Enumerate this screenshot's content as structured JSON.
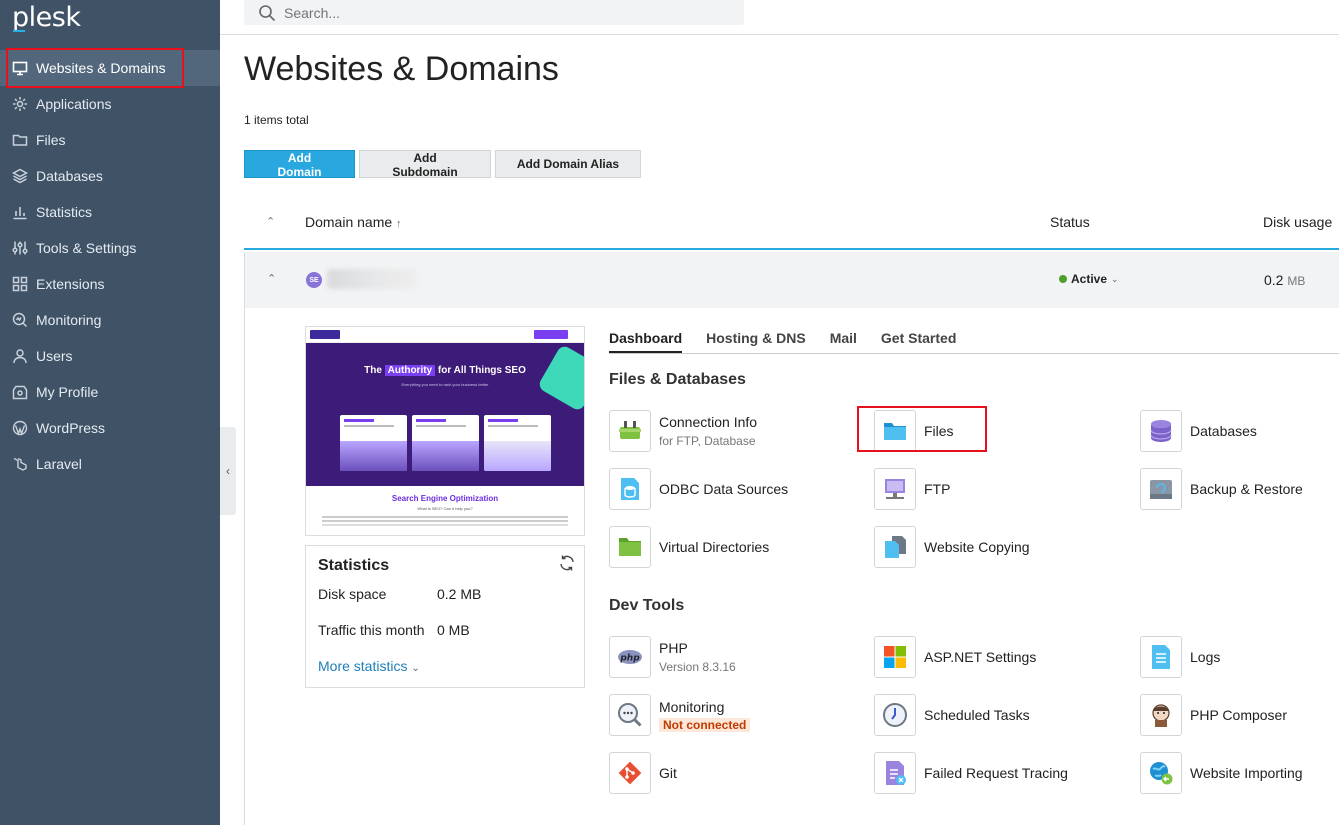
{
  "app": {
    "logo": "plesk"
  },
  "search": {
    "placeholder": "Search..."
  },
  "sidebar": {
    "items": [
      {
        "label": "Websites & Domains",
        "icon": "monitor-icon"
      },
      {
        "label": "Applications",
        "icon": "gear-icon"
      },
      {
        "label": "Files",
        "icon": "folder-icon"
      },
      {
        "label": "Databases",
        "icon": "layers-icon"
      },
      {
        "label": "Statistics",
        "icon": "bar-chart-icon"
      },
      {
        "label": "Tools & Settings",
        "icon": "sliders-icon"
      },
      {
        "label": "Extensions",
        "icon": "extensions-icon"
      },
      {
        "label": "Monitoring",
        "icon": "monitoring-icon"
      },
      {
        "label": "Users",
        "icon": "user-icon"
      },
      {
        "label": "My Profile",
        "icon": "profile-icon"
      },
      {
        "label": "WordPress",
        "icon": "wordpress-icon"
      },
      {
        "label": "Laravel",
        "icon": "laravel-icon"
      }
    ]
  },
  "page": {
    "title": "Websites & Domains",
    "items_total": "1 items total",
    "buttons": {
      "add_domain": "Add Domain",
      "add_subdomain": "Add Subdomain",
      "add_alias": "Add Domain Alias"
    }
  },
  "table": {
    "headers": {
      "domain": "Domain name",
      "sort_arrow": "↑",
      "status": "Status",
      "disk": "Disk usage"
    },
    "row": {
      "status": "Active",
      "disk_value": "0.2",
      "disk_unit": "MB"
    }
  },
  "preview": {
    "title_pre": "The ",
    "title_hl": "Authority",
    "title_post": " for All Things SEO",
    "subtitle": "Everything you need to rank your business better",
    "section": "Search Engine Optimization",
    "question": "What is SEO? Can it help you?"
  },
  "stats": {
    "title": "Statistics",
    "disk_label": "Disk space",
    "disk_value": "0.2 MB",
    "traffic_label": "Traffic this month",
    "traffic_value": "0 MB",
    "more": "More statistics"
  },
  "tabs": [
    "Dashboard",
    "Hosting & DNS",
    "Mail",
    "Get Started"
  ],
  "sections": {
    "files_db": "Files & Databases",
    "dev_tools": "Dev Tools"
  },
  "tools": {
    "connection": {
      "label": "Connection Info",
      "sub": "for FTP, Database"
    },
    "files": {
      "label": "Files"
    },
    "databases": {
      "label": "Databases"
    },
    "odbc": {
      "label": "ODBC Data Sources"
    },
    "ftp": {
      "label": "FTP"
    },
    "backup": {
      "label": "Backup & Restore"
    },
    "virtual_dirs": {
      "label": "Virtual Directories"
    },
    "website_copying": {
      "label": "Website Copying"
    },
    "php": {
      "label": "PHP",
      "sub": "Version 8.3.16"
    },
    "aspnet": {
      "label": "ASP.NET Settings"
    },
    "logs": {
      "label": "Logs"
    },
    "monitoring": {
      "label": "Monitoring",
      "badge": "Not connected"
    },
    "scheduled": {
      "label": "Scheduled Tasks"
    },
    "composer": {
      "label": "PHP Composer"
    },
    "git": {
      "label": "Git"
    },
    "failed": {
      "label": "Failed Request Tracing"
    },
    "importing": {
      "label": "Website Importing"
    }
  },
  "colors": {
    "sidebar_bg": "#3f5266",
    "accent": "#29a8e0",
    "highlight": "#e8111b",
    "active": "#4e9f2a"
  }
}
